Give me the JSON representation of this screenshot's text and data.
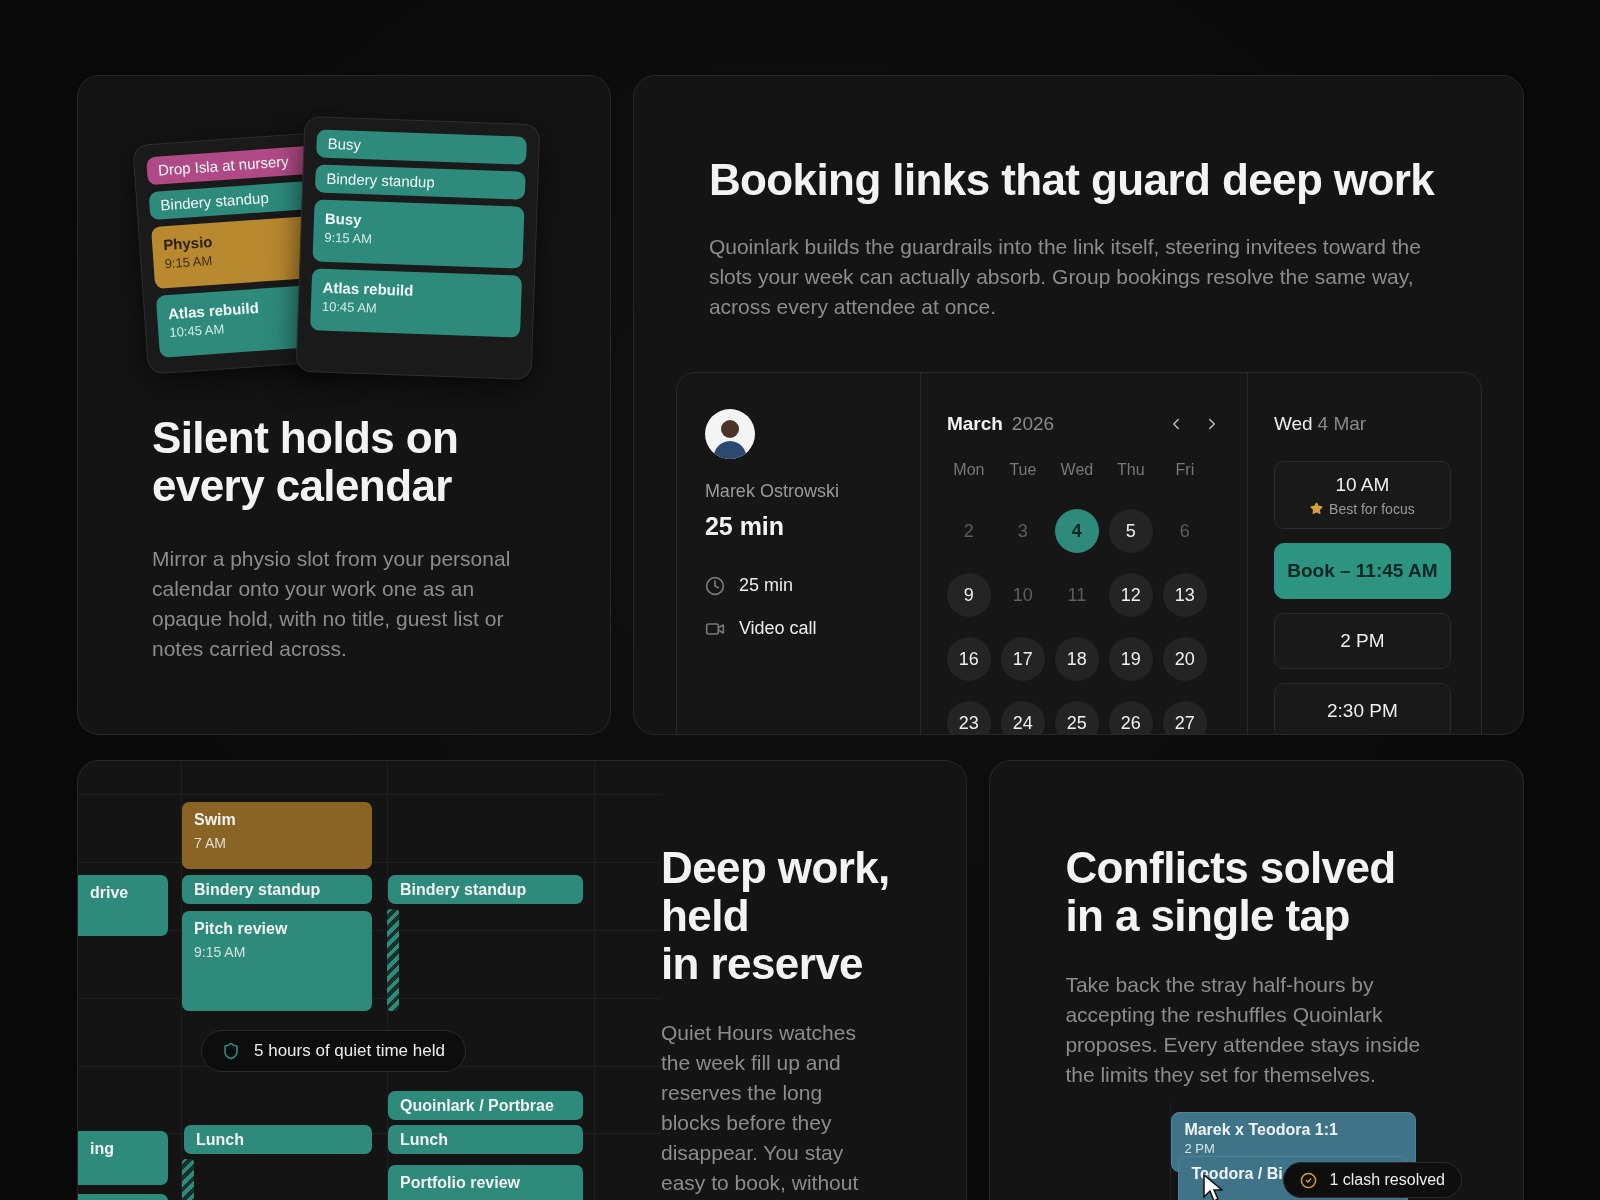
{
  "holds_card": {
    "calendars": [
      {
        "events": [
          {
            "title": "Drop Isla at nursery",
            "color": "#b04a86"
          },
          {
            "title": "Bindery standup",
            "color": "#2e8b7c"
          },
          {
            "title": "Physio",
            "time": "9:15 AM",
            "color": "#b8892f"
          },
          {
            "title": "Atlas rebuild",
            "time": "10:45 AM",
            "color": "#2e8b7c"
          }
        ]
      },
      {
        "events": [
          {
            "title": "Busy",
            "color": "#2e8b7c"
          },
          {
            "title": "Bindery standup",
            "color": "#2e8b7c"
          },
          {
            "title": "Busy",
            "time": "9:15 AM",
            "color": "#2e8b7c"
          },
          {
            "title": "Atlas rebuild",
            "time": "10:45 AM",
            "color": "#2e8b7c"
          }
        ]
      }
    ],
    "title_lines": [
      "Silent holds on",
      "every calendar"
    ],
    "body": "Mirror a physio slot from your personal calendar onto your work one as an opaque hold, with no title, guest list or notes carried across."
  },
  "booking_card": {
    "title_lines": [
      "Booking links that guard deep work"
    ],
    "body": "Quoinlark builds the guardrails into the link itself, steering invitees toward the slots your week can actually absorb. Group bookings resolve the same way, across every attendee at once.",
    "host": {
      "name": "Marek Ostrowski",
      "duration": "25 min",
      "details": [
        {
          "kind": "clock",
          "label": "25 min"
        },
        {
          "kind": "video",
          "label": "Video call"
        }
      ]
    },
    "calendar": {
      "month": "March",
      "year": "2026",
      "weekdays": [
        "Mon",
        "Tue",
        "Wed",
        "Thu",
        "Fri"
      ],
      "days": [
        {
          "label": "2",
          "available": false,
          "selected": false
        },
        {
          "label": "3",
          "available": false,
          "selected": false
        },
        {
          "label": "4",
          "available": true,
          "selected": true
        },
        {
          "label": "5",
          "available": true,
          "selected": false
        },
        {
          "label": "6",
          "available": false,
          "selected": false
        },
        {
          "label": "9",
          "available": true,
          "selected": false
        },
        {
          "label": "10",
          "available": false,
          "selected": false
        },
        {
          "label": "11",
          "available": false,
          "selected": false
        },
        {
          "label": "12",
          "available": true,
          "selected": false
        },
        {
          "label": "13",
          "available": true,
          "selected": false
        },
        {
          "label": "16",
          "available": true,
          "selected": false
        },
        {
          "label": "17",
          "available": true,
          "selected": false
        },
        {
          "label": "18",
          "available": true,
          "selected": false
        },
        {
          "label": "19",
          "available": true,
          "selected": false
        },
        {
          "label": "20",
          "available": true,
          "selected": false
        },
        {
          "label": "23",
          "available": true,
          "selected": false
        },
        {
          "label": "24",
          "available": true,
          "selected": false
        },
        {
          "label": "25",
          "available": true,
          "selected": false
        },
        {
          "label": "26",
          "available": true,
          "selected": false
        },
        {
          "label": "27",
          "available": true,
          "selected": false
        }
      ]
    },
    "date": {
      "weekday": "Wed",
      "day": "4 Mar"
    },
    "slots": [
      {
        "kind": "slot",
        "label": "10 AM",
        "note": "Best for focus"
      },
      {
        "kind": "book",
        "label": "Book – 11:45 AM"
      },
      {
        "kind": "slot",
        "label": "2 PM"
      },
      {
        "kind": "slot",
        "label": "2:30 PM"
      }
    ]
  },
  "reserve_card": {
    "events": [
      {
        "title": "Swim",
        "time": "7 AM",
        "color": "#8a6424"
      },
      {
        "title": "drive",
        "color": "#2e8b7c"
      },
      {
        "title": "Bindery standup",
        "color": "#2e8b7c"
      },
      {
        "title": "Bindery standup",
        "color": "#2e8b7c"
      },
      {
        "title": "Pitch review",
        "time": "9:15 AM",
        "color": "#2e8b7c"
      },
      {
        "title": "Quoinlark / Portbrae",
        "color": "#2e8b7c"
      },
      {
        "title": "Lunch",
        "color": "#2e8b7c"
      },
      {
        "title": "Lunch",
        "color": "#2e8b7c"
      },
      {
        "title": "ing",
        "color": "#2e8b7c"
      },
      {
        "title": "Portfolio review",
        "color": "#2e8b7c"
      }
    ],
    "badge": "5 hours of quiet time held",
    "title_lines": [
      "Deep work,",
      "held",
      "in reserve"
    ],
    "body": "Quiet Hours watches the week fill up and reserves the long blocks before they disappear. You stay easy to book, without"
  },
  "conflicts_card": {
    "title_lines": [
      "Conflicts solved",
      "in a single tap"
    ],
    "body": "Take back the stray half-hours by accepting the reshuffles Quoinlark proposes. Every attendee stays inside the limits they set for themselves.",
    "events": [
      {
        "title": "Marek x Teodora 1:1",
        "time": "2 PM"
      },
      {
        "title": "Teodora / Bi"
      }
    ],
    "badge": "1 clash resolved"
  }
}
